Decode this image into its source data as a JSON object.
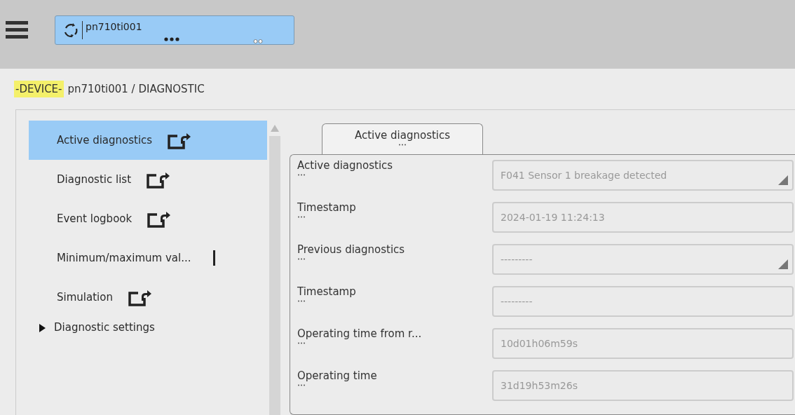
{
  "device_selector": {
    "name": "pn710ti001"
  },
  "breadcrumb": {
    "tag": "-DEVICE-",
    "path": "pn710ti001 / DIAGNOSTIC"
  },
  "sidebar": {
    "items": [
      {
        "label": "Active diagnostics",
        "kind": "link",
        "selected": true
      },
      {
        "label": "Diagnostic list",
        "kind": "link",
        "selected": false
      },
      {
        "label": "Event logbook",
        "kind": "link",
        "selected": false
      },
      {
        "label": "Minimum/maximum val...",
        "kind": "plain",
        "selected": false
      },
      {
        "label": "Simulation",
        "kind": "link",
        "selected": false
      },
      {
        "label": "Diagnostic settings",
        "kind": "group",
        "expanded": false,
        "selected": false
      }
    ]
  },
  "tabs": [
    {
      "label": "Active diagnostics",
      "selected": true
    }
  ],
  "fields": [
    {
      "label": "Active diagnostics",
      "kind": "dropdown",
      "value": "F041 Sensor 1 breakage detected"
    },
    {
      "label": "Timestamp",
      "kind": "text",
      "value": "2024-01-19 11:24:13"
    },
    {
      "label": "Previous diagnostics",
      "kind": "dropdown",
      "value": "---------"
    },
    {
      "label": "Timestamp",
      "kind": "text",
      "value": "---------"
    },
    {
      "label": "Operating time from r...",
      "kind": "text",
      "value": "10d01h06m59s"
    },
    {
      "label": "Operating time",
      "kind": "text",
      "value": "31d19h53m26s"
    }
  ]
}
